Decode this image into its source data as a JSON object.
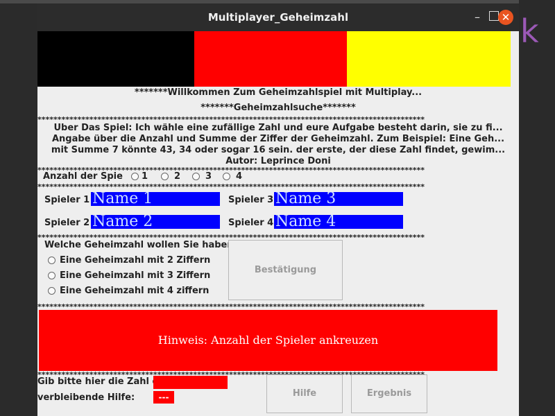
{
  "window": {
    "title": "Multiplayer_Geheimzahl"
  },
  "colors": {
    "flag_black": "#000000",
    "flag_red": "#ff0000",
    "flag_gold": "#ffff00",
    "name_field": "#0000ff",
    "accent_close": "#e95420"
  },
  "header": {
    "welcome": "*******Willkommen Zum Geheimzahlspiel mit Multiplay...",
    "subtitle": "*******Geheimzahlsuche*******"
  },
  "separator": "*************************************************************************************************",
  "about": {
    "line1": "Über Das Spiel: Ich wähle eine zufällige Zahl und eure Aufgabe besteht darin, sie zu fi...",
    "line2": "Angabe über die Anzahl und Summe der Ziffer der Geheimzahl. Zum Beispiel: Eine Geh...",
    "line3": "mit Summe 7 könnte 43, 34 oder sogar 16 sein. der erste, der diese Zahl findet, gewim...",
    "author": "Autor: Leprince Doni"
  },
  "player_count": {
    "label": "Anzahl der Spie",
    "options": [
      "1",
      "2",
      "3",
      "4"
    ]
  },
  "players": [
    {
      "label": "Spieler 1",
      "name": "Name 1"
    },
    {
      "label": "Spieler 2",
      "name": "Name 2"
    },
    {
      "label": "Spieler 3",
      "name": "Name 3"
    },
    {
      "label": "Spieler 4",
      "name": "Name 4"
    }
  ],
  "secret": {
    "question": "Welche Geheimzahl wollen Sie haben?",
    "options": [
      "Eine Geheimzahl mit 2 Ziffern",
      "Eine Geheimzahl mit 3 Ziffern",
      "Eine Geheimzahl mit 4 ziffern"
    ],
    "confirm_label": "Bestätigung"
  },
  "hint": "Hinweis: Anzahl der Spieler ankreuzen",
  "bottom": {
    "enter_label": "Gib bitte hier die Zahl ein:",
    "remaining_label": "verbleibende Hilfe:",
    "remaining_value": "---",
    "help_button": "Hilfe",
    "result_button": "Ergebnis"
  }
}
